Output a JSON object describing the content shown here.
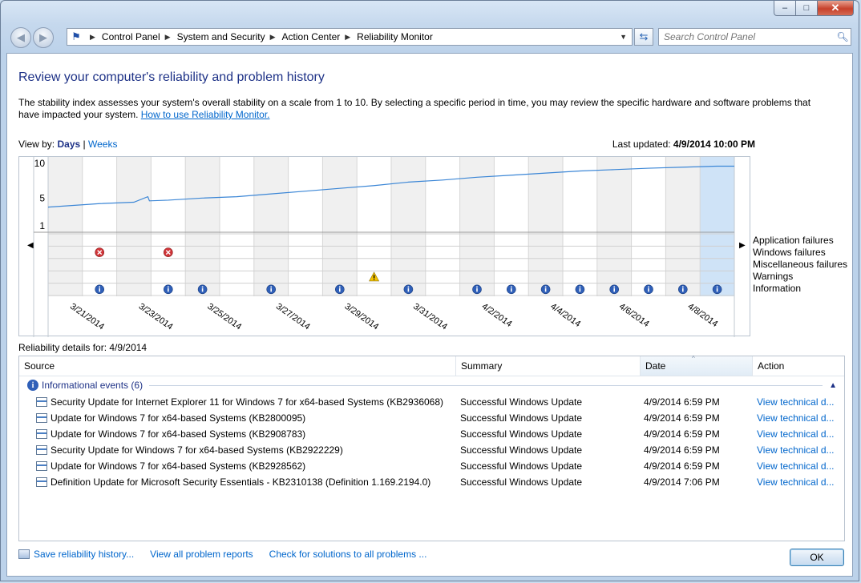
{
  "window": {
    "caption_min": "–",
    "caption_max": "□",
    "caption_close": "✕"
  },
  "nav": {
    "back_glyph": "◀",
    "forward_glyph": "▶",
    "breadcrumb": [
      "Control Panel",
      "System and Security",
      "Action Center",
      "Reliability Monitor"
    ],
    "search_placeholder": "Search Control Panel"
  },
  "page": {
    "title": "Review your computer's reliability and problem history",
    "description": "The stability index assesses your system's overall stability on a scale from 1 to 10. By selecting a specific period in time, you may review the specific hardware and software problems that have impacted your system.",
    "help_link": "How to use Reliability Monitor.",
    "view_by_label": "View by:",
    "view_days": "Days",
    "view_sep": "|",
    "view_weeks": "Weeks",
    "last_updated_label": "Last updated:",
    "last_updated_value": "4/9/2014 10:00 PM"
  },
  "chart_data": {
    "type": "line",
    "title": "",
    "y_ticks": [
      "10",
      "5",
      "1"
    ],
    "ylim": [
      1,
      10
    ],
    "days": 20,
    "selected_day_index": 19,
    "x_tick_labels": [
      "3/21/2014",
      "3/23/2014",
      "3/25/2014",
      "3/27/2014",
      "3/29/2014",
      "3/31/2014",
      "4/2/2014",
      "4/4/2014",
      "4/6/2014",
      "4/8/2014"
    ],
    "stability_index": [
      3.7,
      4.2,
      4.4,
      4.7,
      5.0,
      5.2,
      5.6,
      6.0,
      6.4,
      6.8,
      7.3,
      7.6,
      8.0,
      8.3,
      8.6,
      8.9,
      9.1,
      9.3,
      9.45,
      9.6
    ],
    "stability_drop": {
      "day_index": 3,
      "from": 5.2,
      "to": 4.6
    },
    "rows": [
      "Application failures",
      "Windows failures",
      "Miscellaneous failures",
      "Warnings",
      "Information"
    ],
    "events": {
      "windows_failures": [
        1,
        3
      ],
      "warnings": [
        9
      ],
      "information": [
        1,
        3,
        4,
        6,
        8,
        10,
        12,
        13,
        14,
        15,
        16,
        17,
        18,
        19
      ]
    },
    "colors": {
      "line": "#3b86d6",
      "shade": "#f0f0f0",
      "selected": "#cfe3f7",
      "error": "#d13438",
      "warning": "#f5c400",
      "info": "#2f5fb8"
    }
  },
  "details": {
    "label": "Reliability details for: 4/9/2014",
    "columns": [
      "Source",
      "Summary",
      "Date",
      "Action"
    ],
    "group_label": "Informational events (6)",
    "rows": [
      {
        "source": "Security Update for Internet Explorer 11 for Windows 7 for x64-based Systems (KB2936068)",
        "summary": "Successful Windows Update",
        "date": "4/9/2014 6:59 PM",
        "action": "View  technical d..."
      },
      {
        "source": "Update for Windows 7 for x64-based Systems (KB2800095)",
        "summary": "Successful Windows Update",
        "date": "4/9/2014 6:59 PM",
        "action": "View  technical d..."
      },
      {
        "source": "Update for Windows 7 for x64-based Systems (KB2908783)",
        "summary": "Successful Windows Update",
        "date": "4/9/2014 6:59 PM",
        "action": "View  technical d..."
      },
      {
        "source": "Security Update for Windows 7 for x64-based Systems (KB2922229)",
        "summary": "Successful Windows Update",
        "date": "4/9/2014 6:59 PM",
        "action": "View  technical d..."
      },
      {
        "source": "Update for Windows 7 for x64-based Systems (KB2928562)",
        "summary": "Successful Windows Update",
        "date": "4/9/2014 6:59 PM",
        "action": "View  technical d..."
      },
      {
        "source": "Definition Update for Microsoft Security Essentials - KB2310138 (Definition 1.169.2194.0)",
        "summary": "Successful Windows Update",
        "date": "4/9/2014 7:06 PM",
        "action": "View  technical d..."
      }
    ]
  },
  "footer": {
    "save_link": "Save reliability history...",
    "problems_link": "View all problem reports",
    "solutions_link": "Check for solutions to all problems ...",
    "ok_label": "OK"
  },
  "icons": {
    "flag": "flag-icon",
    "search": "search-icon",
    "refresh": "refresh-icon",
    "info": "info-icon",
    "error": "error-icon",
    "warning": "warning-icon"
  }
}
